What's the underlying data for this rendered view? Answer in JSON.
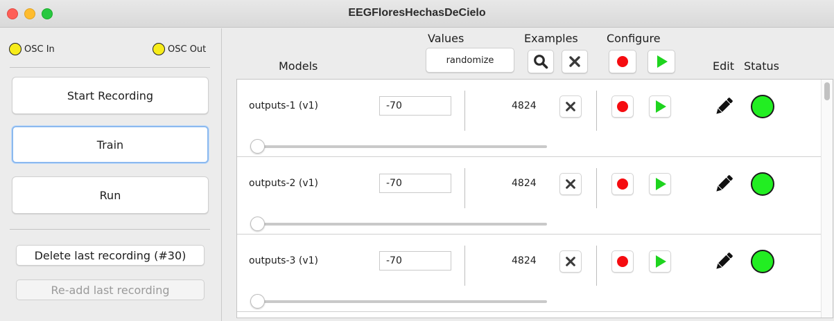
{
  "window": {
    "title": "EEGFloresHechasDeCielo"
  },
  "left_panel": {
    "osc_in_label": "OSC In",
    "osc_out_label": "OSC Out",
    "start_recording_label": "Start Recording",
    "train_label": "Train",
    "run_label": "Run",
    "delete_last_label": "Delete last recording (#30)",
    "readd_last_label": "Re-add last recording"
  },
  "header": {
    "models_label": "Models",
    "values_label": "Values",
    "randomize_label": "randomize",
    "examples_label": "Examples",
    "configure_label": "Configure",
    "edit_label": "Edit",
    "status_label": "Status"
  },
  "models": [
    {
      "name": "outputs-1 (v1)",
      "value": "-70",
      "examples": "4824",
      "slider_fraction": 0.0
    },
    {
      "name": "outputs-2 (v1)",
      "value": "-70",
      "examples": "4824",
      "slider_fraction": 0.0
    },
    {
      "name": "outputs-3 (v1)",
      "value": "-70",
      "examples": "4824",
      "slider_fraction": 0.0
    }
  ],
  "colors": {
    "osc_led": "#f7ec1a",
    "record": "#f50c10",
    "play": "#1ed41e",
    "status_ok": "#22ee22"
  },
  "icons": {
    "search": "magnifier-icon",
    "clear": "x-icon",
    "record": "record-icon",
    "run": "play-icon",
    "edit": "pencil-icon",
    "status": "status-indicator"
  }
}
